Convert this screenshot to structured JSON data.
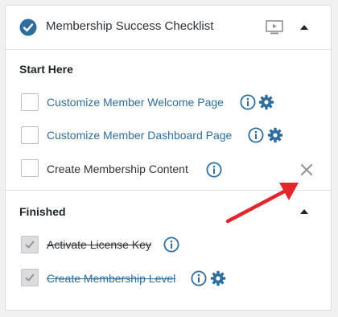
{
  "header": {
    "title": "Membership Success Checklist"
  },
  "sections": [
    {
      "title": "Start Here",
      "items": [
        {
          "label": "Customize Member Welcome Page",
          "checked": false,
          "link": true
        },
        {
          "label": "Customize Member Dashboard Page",
          "checked": false,
          "link": true
        },
        {
          "label": "Create Membership Content",
          "checked": false,
          "link": false
        }
      ]
    },
    {
      "title": "Finished",
      "items": [
        {
          "label": "Activate License Key",
          "checked": true,
          "link": false
        },
        {
          "label": "Create Membership Level",
          "checked": true,
          "link": true
        }
      ]
    }
  ],
  "colors": {
    "accent": "#2f6d9c",
    "arrow": "#e3262b",
    "text": "#2c3338"
  },
  "icons": [
    "check-circle-icon",
    "screen-icon",
    "caret-up-icon",
    "info-icon",
    "gear-icon",
    "close-icon"
  ]
}
